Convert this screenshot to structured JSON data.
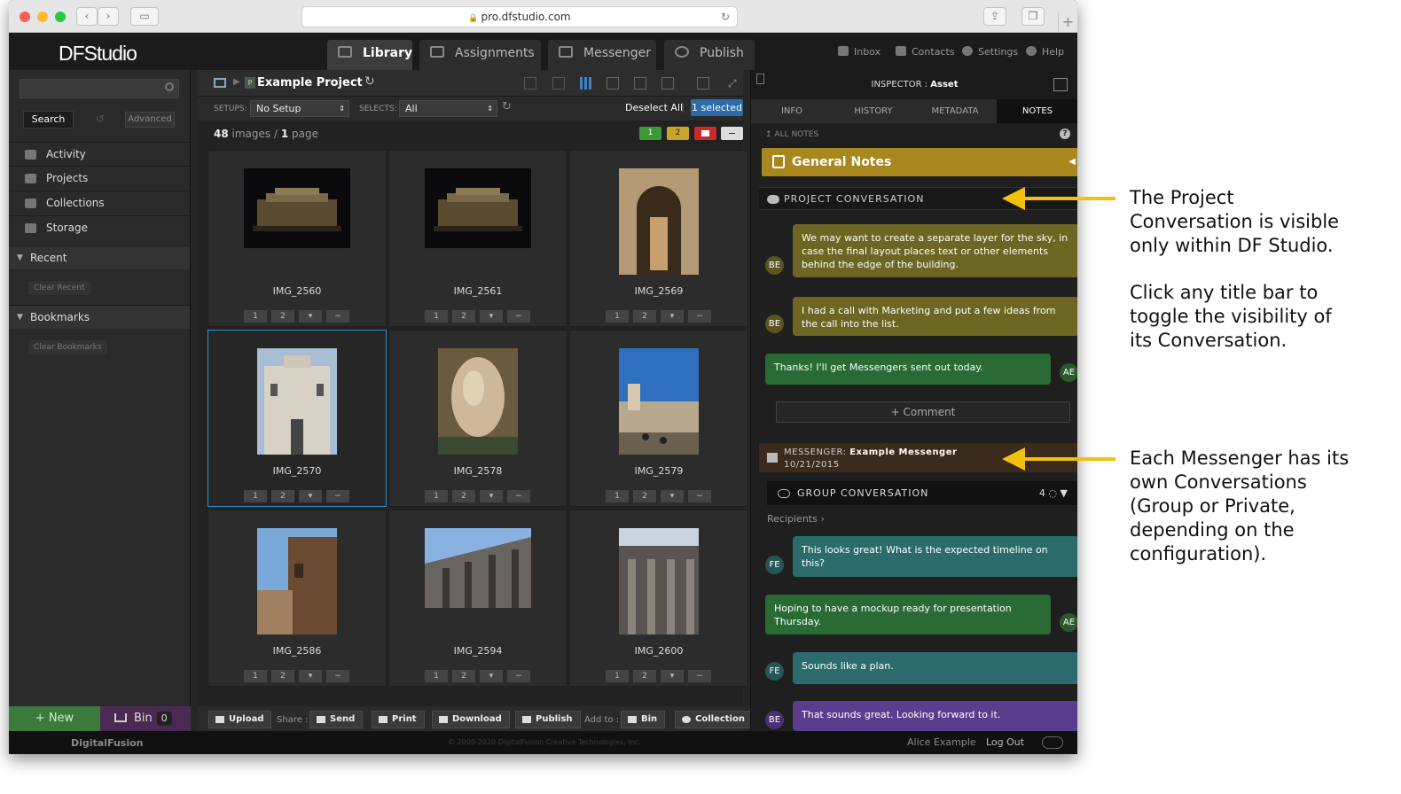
{
  "browser": {
    "url": "pro.dfstudio.com"
  },
  "app": {
    "logo": "DFStudio"
  },
  "main_tabs": [
    {
      "label": "Library"
    },
    {
      "label": "Assignments"
    },
    {
      "label": "Messenger"
    },
    {
      "label": "Publish"
    }
  ],
  "top_right": {
    "inbox": "Inbox",
    "contacts": "Contacts",
    "settings": "Settings",
    "help": "Help"
  },
  "sidebar": {
    "search_button": "Search",
    "advanced_button": "Advanced",
    "items": [
      {
        "label": "Activity"
      },
      {
        "label": "Projects"
      },
      {
        "label": "Collections"
      },
      {
        "label": "Storage"
      }
    ],
    "recent": "Recent",
    "clear_recent": "Clear Recent",
    "bookmarks": "Bookmarks",
    "clear_bookmarks": "Clear Bookmarks",
    "new_button": "+ New",
    "bin_button": "Bin",
    "bin_count": "0"
  },
  "center": {
    "project_title": "Example Project",
    "setups_label": "SETUPS:",
    "setups_value": "No Setup",
    "selects_label": "SELECTS:",
    "selects_value": "All",
    "deselect_all": "Deselect All",
    "selected_badge": "1 selected",
    "image_count": "48",
    "images_word": "images /",
    "page_count": "1",
    "page_word": "page",
    "rating_buttons": [
      "1",
      "2",
      "−"
    ],
    "cell_buttons": [
      "1",
      "2",
      "−"
    ],
    "images": [
      {
        "name": "IMG_2560"
      },
      {
        "name": "IMG_2561"
      },
      {
        "name": "IMG_2569"
      },
      {
        "name": "IMG_2570"
      },
      {
        "name": "IMG_2578"
      },
      {
        "name": "IMG_2579"
      },
      {
        "name": "IMG_2586"
      },
      {
        "name": "IMG_2594"
      },
      {
        "name": "IMG_2600"
      }
    ],
    "bottom": {
      "upload": "Upload",
      "share_label": "Share :",
      "send": "Send",
      "print": "Print",
      "download": "Download",
      "publish": "Publish",
      "add_to_label": "Add to :",
      "bin": "Bin",
      "collection": "Collection"
    }
  },
  "inspector": {
    "title_prefix": "INSPECTOR :",
    "title": "Asset",
    "tabs": [
      {
        "label": "INFO"
      },
      {
        "label": "HISTORY"
      },
      {
        "label": "METADATA"
      },
      {
        "label": "NOTES"
      }
    ],
    "all_notes": "ALL NOTES",
    "general_notes": "General Notes",
    "project_conversation": "PROJECT CONVERSATION",
    "project_messages": [
      {
        "initials": "BE",
        "text": "We may want to create a separate layer for the sky, in case the final layout places text or other elements behind the edge of the building."
      },
      {
        "initials": "BE",
        "text": "I had a call with Marketing and put a few ideas from the call into the list."
      },
      {
        "initials": "AE",
        "text": "Thanks! I'll get Messengers sent out today."
      }
    ],
    "comment_button": "+ Comment",
    "messenger_label": "MESSENGER:",
    "messenger_name": "Example Messenger",
    "messenger_date": "10/21/2015",
    "group_conversation": "GROUP CONVERSATION",
    "group_count": "4",
    "recipients": "Recipients ›",
    "group_messages": [
      {
        "initials": "FE",
        "text": "This looks great! What is the expected timeline on this?"
      },
      {
        "initials": "AE",
        "text": "Hoping to have a mockup ready for presentation Thursday."
      },
      {
        "initials": "FE",
        "text": "Sounds like a plan."
      },
      {
        "initials": "BE",
        "text": "That sounds great. Looking forward to it."
      }
    ]
  },
  "footer": {
    "logo": "DigitalFusion",
    "copyright": "© 2000-2020 DigitalFusion Creative Technologies, Inc.",
    "user": "Alice Example",
    "logout": "Log Out"
  },
  "callouts": {
    "project": [
      "The Project",
      "Conversation is visible",
      "only within DF Studio."
    ],
    "toggle": [
      "Click any title bar to",
      "toggle the visibility of",
      "its Conversation."
    ],
    "messenger": [
      "Each Messenger has its",
      "own Conversations",
      "(Group or Private,",
      "depending on the",
      "configuration)."
    ]
  },
  "colors": {
    "accent_blue": "#2c6aa8",
    "general_notes": "#a8881e",
    "callout_arrow": "#f3c10d"
  }
}
